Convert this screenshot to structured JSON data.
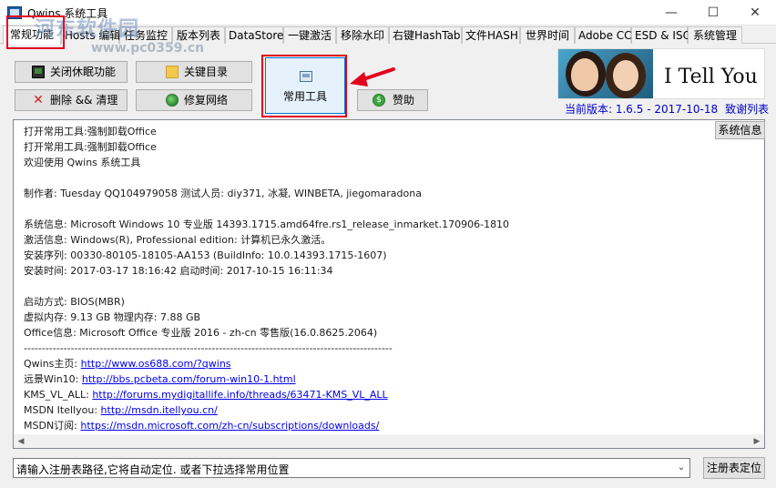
{
  "window": {
    "title": "Qwins 系统工具",
    "minimize_glyph": "—",
    "maximize_glyph": "☐",
    "close_glyph": "✕"
  },
  "watermark": {
    "site_name": "河东软件园",
    "url": "www.pc0359.cn"
  },
  "tabs": [
    {
      "label": "常规功能",
      "active": true
    },
    {
      "label": "Hosts 编辑",
      "active": false
    },
    {
      "label": "任务监控",
      "active": false
    },
    {
      "label": "版本列表",
      "active": false
    },
    {
      "label": "DataStore",
      "active": false
    },
    {
      "label": "一键激活",
      "active": false
    },
    {
      "label": "移除水印",
      "active": false
    },
    {
      "label": "右键HashTab",
      "active": false
    },
    {
      "label": "文件HASH",
      "active": false
    },
    {
      "label": "世界时间",
      "active": false
    },
    {
      "label": "Adobe CC",
      "active": false
    },
    {
      "label": "ESD & ISO",
      "active": false
    },
    {
      "label": "系统管理",
      "active": false
    }
  ],
  "actions": {
    "sleep_off": "关闭休眠功能",
    "key_dirs": "关键目录",
    "delete_clean": "删除 && 清理",
    "repair_network": "修复网络",
    "common_tools": "常用工具",
    "donate": "赞助",
    "donate_icon_glyph": "$"
  },
  "icons": {
    "sleep_off": "monitor-icon",
    "key_dirs": "folder-icon",
    "delete_clean": "delete-x-icon",
    "repair_network": "globe-icon",
    "common_tools": "window-icon",
    "donate": "coin-icon"
  },
  "brand": {
    "slogan": "I Tell You"
  },
  "version": {
    "text": "当前版本: 1.6.5 - 2017-10-18",
    "thanks": "致谢列表"
  },
  "sysinfo_button": "系统信息",
  "log": {
    "lines": [
      "打开常用工具:强制卸载Office",
      "打开常用工具:强制卸载Office",
      "欢迎使用 Qwins 系统工具",
      "",
      " 制作者: Tuesday QQ104979058 测试人员: diy371, 冰凝, WINBETA, jiegomaradona",
      "",
      "系统信息: Microsoft Windows 10 专业版 14393.1715.amd64fre.rs1_release_inmarket.170906-1810",
      "激活信息: Windows(R), Professional edition:  计算机已永久激活。",
      "安装序列: 00330-80105-18105-AA153 (BuildInfo: 10.0.14393.1715-1607)",
      "安装时间: 2017-03-17 18:16:42 启动时间: 2017-10-15 16:11:34",
      "",
      "启动方式: BIOS(MBR)",
      "虚拟内存: 9.13 GB 物理内存: 7.88 GB",
      "Office信息: Microsoft Office 专业版 2016 - zh-cn 零售版(16.0.8625.2064)",
      "------------------------------------------------------------------------------------------------------"
    ],
    "links": [
      {
        "prefix": "Qwins主页: ",
        "url": "http://www.os688.com/?qwins"
      },
      {
        "prefix": "远景Win10:  ",
        "url": "http://bbs.pcbeta.com/forum-win10-1.html"
      },
      {
        "prefix": "KMS_VL_ALL: ",
        "url": "http://forums.mydigitallife.info/threads/63471-KMS_VL_ALL"
      },
      {
        "prefix": "MSDN Itellyou:  ",
        "url": "http://msdn.itellyou.cn/"
      },
      {
        "prefix": "MSDN订阅: ",
        "url": "https://msdn.microsoft.com/zh-cn/subscriptions/downloads/"
      }
    ]
  },
  "registry": {
    "value": "请输入注册表路径,它将自动定位. 或者下拉选择常用位置",
    "dropdown_glyph": "⌄",
    "locate_button": "注册表定位"
  },
  "scroll_glyphs": {
    "down": "▼",
    "left": "◀",
    "right": "▶"
  },
  "accent_colors": {
    "highlight": "#e3001b",
    "link": "#0000ee",
    "version": "#0000cc",
    "selected_button_border": "#0078d7"
  }
}
